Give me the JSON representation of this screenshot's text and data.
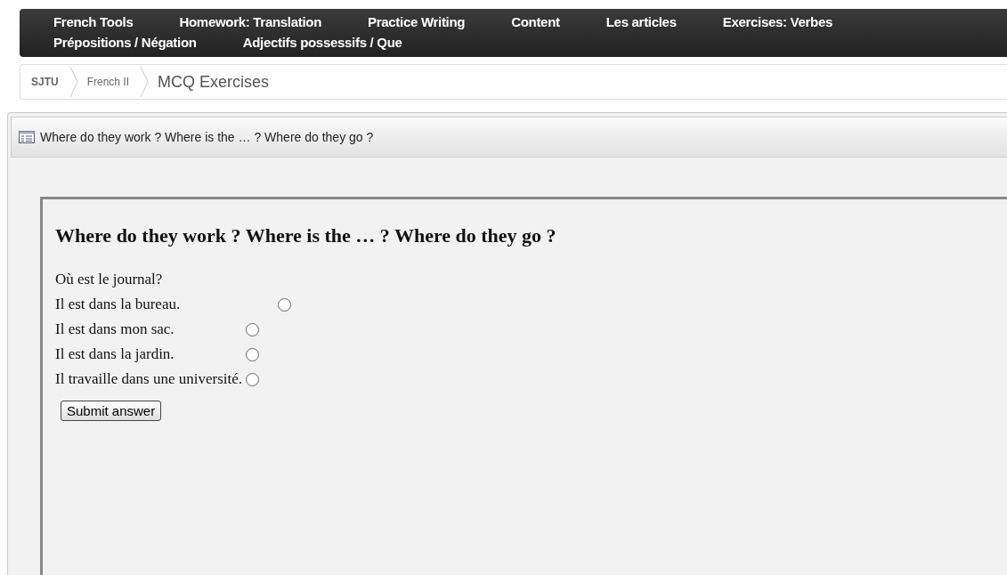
{
  "nav": {
    "items": [
      {
        "label": "French Tools"
      },
      {
        "label": "Homework: Translation"
      },
      {
        "label": "Practice Writing"
      },
      {
        "label": "Content"
      },
      {
        "label": "Les articles"
      },
      {
        "label": "Exercises: Verbes"
      },
      {
        "label": "Prépositions / Négation"
      },
      {
        "label": "Adjectifs possessifs / Que"
      }
    ]
  },
  "breadcrumb": [
    {
      "label": "SJTU"
    },
    {
      "label": "French II"
    },
    {
      "label": "MCQ Exercises"
    }
  ],
  "panel": {
    "title": "Where do they work ? Where is the … ? Where do they go ?"
  },
  "quiz": {
    "heading": "Where do they work ? Where is the … ? Where do they go ?",
    "question": "Où est le journal?",
    "options": [
      {
        "label": "Il est dans la bureau.",
        "selected": false
      },
      {
        "label": "Il est dans mon sac.",
        "selected": false
      },
      {
        "label": "Il est dans la jardin.",
        "selected": false
      },
      {
        "label": "Il travaille dans une université.",
        "selected": false
      }
    ],
    "submit": "Submit answer"
  }
}
